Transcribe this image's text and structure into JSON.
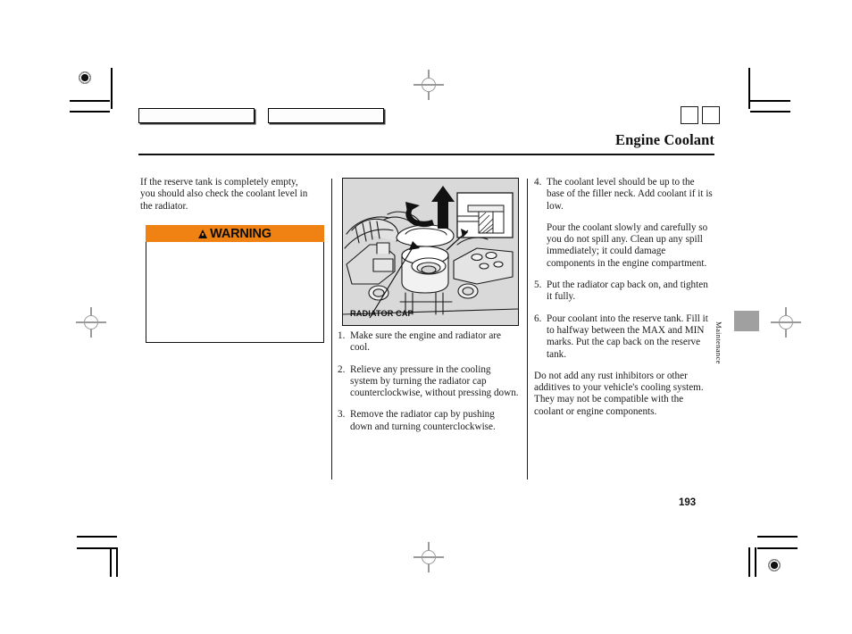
{
  "document": {
    "chapter_title": "Engine Coolant",
    "page_number": "193",
    "side_tab_label": "Maintenance"
  },
  "left_column": {
    "intro_paragraph": "If the reserve tank is completely empty, you should also check the coolant level in the radiator.",
    "warning": {
      "label": "WARNING",
      "icon": "warning-triangle-icon",
      "header_color": "#F08113",
      "body_text": ""
    }
  },
  "figure": {
    "caption": "RADIATOR CAP",
    "background_color": "#d9d9d9",
    "description": "Line drawing of an engine bay radiator filler neck with the radiator cap being turned counterclockwise; inset shows cross-section of the filler neck."
  },
  "middle_column": {
    "steps": [
      {
        "num": "1.",
        "text": "Make sure the engine and radiator are cool."
      },
      {
        "num": "2.",
        "text": "Relieve any pressure in the cooling system by turning the radiator cap counterclockwise, without pressing down."
      },
      {
        "num": "3.",
        "text": "Remove the radiator cap by pushing down and turning counterclockwise."
      }
    ]
  },
  "right_column": {
    "steps": [
      {
        "num": "4.",
        "text": "The coolant level should be up to the base of the filler neck. Add coolant if it is low."
      },
      {
        "num": "5.",
        "text": "Put the radiator cap back on, and tighten it fully."
      },
      {
        "num": "6.",
        "text": "Pour coolant into the reserve tank. Fill it to halfway between the MAX and MIN marks. Put the cap back on the reserve tank."
      }
    ],
    "step4_note": "Pour the coolant slowly and carefully so you do not spill any. Clean up any spill immediately; it could damage components in the engine compartment.",
    "closing_note": "Do not add any rust inhibitors or other additives to your vehicle's cooling system. They may not be compatible with the coolant or engine components."
  },
  "print_marks": {
    "registration_icon": "registration-target-icon",
    "crosshair_icon": "registration-crosshair-icon",
    "header_boxes_count": 2
  }
}
